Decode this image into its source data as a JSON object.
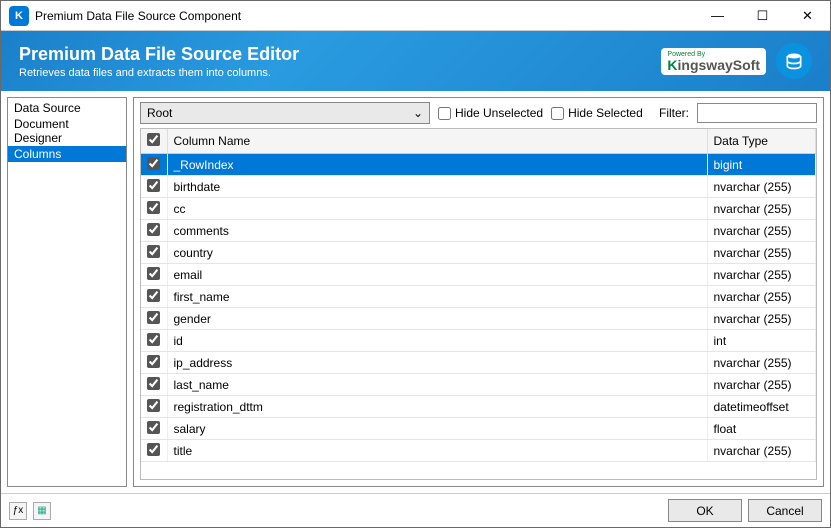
{
  "window": {
    "title": "Premium Data File Source Component"
  },
  "banner": {
    "title": "Premium Data File Source Editor",
    "subtitle": "Retrieves data files and extracts them into columns.",
    "powered_by": "Powered By",
    "brand_k": "K",
    "brand_rest": "ingswaySoft"
  },
  "sidebar": {
    "items": [
      {
        "label": "Data Source",
        "selected": false
      },
      {
        "label": "Document Designer",
        "selected": false
      },
      {
        "label": "Columns",
        "selected": true
      }
    ]
  },
  "toolbar": {
    "combo_value": "Root",
    "hide_unselected": "Hide Unselected",
    "hide_selected": "Hide Selected",
    "filter_label": "Filter:",
    "filter_value": ""
  },
  "grid": {
    "headers": {
      "name": "Column Name",
      "type": "Data Type"
    },
    "rows": [
      {
        "checked": true,
        "name": "_RowIndex",
        "type": "bigint",
        "selected": true
      },
      {
        "checked": true,
        "name": "birthdate",
        "type": "nvarchar (255)",
        "selected": false
      },
      {
        "checked": true,
        "name": "cc",
        "type": "nvarchar (255)",
        "selected": false
      },
      {
        "checked": true,
        "name": "comments",
        "type": "nvarchar (255)",
        "selected": false
      },
      {
        "checked": true,
        "name": "country",
        "type": "nvarchar (255)",
        "selected": false
      },
      {
        "checked": true,
        "name": "email",
        "type": "nvarchar (255)",
        "selected": false
      },
      {
        "checked": true,
        "name": "first_name",
        "type": "nvarchar (255)",
        "selected": false
      },
      {
        "checked": true,
        "name": "gender",
        "type": "nvarchar (255)",
        "selected": false
      },
      {
        "checked": true,
        "name": "id",
        "type": "int",
        "selected": false
      },
      {
        "checked": true,
        "name": "ip_address",
        "type": "nvarchar (255)",
        "selected": false
      },
      {
        "checked": true,
        "name": "last_name",
        "type": "nvarchar (255)",
        "selected": false
      },
      {
        "checked": true,
        "name": "registration_dttm",
        "type": "datetimeoffset",
        "selected": false
      },
      {
        "checked": true,
        "name": "salary",
        "type": "float",
        "selected": false
      },
      {
        "checked": true,
        "name": "title",
        "type": "nvarchar (255)",
        "selected": false
      }
    ]
  },
  "footer": {
    "ok": "OK",
    "cancel": "Cancel"
  }
}
